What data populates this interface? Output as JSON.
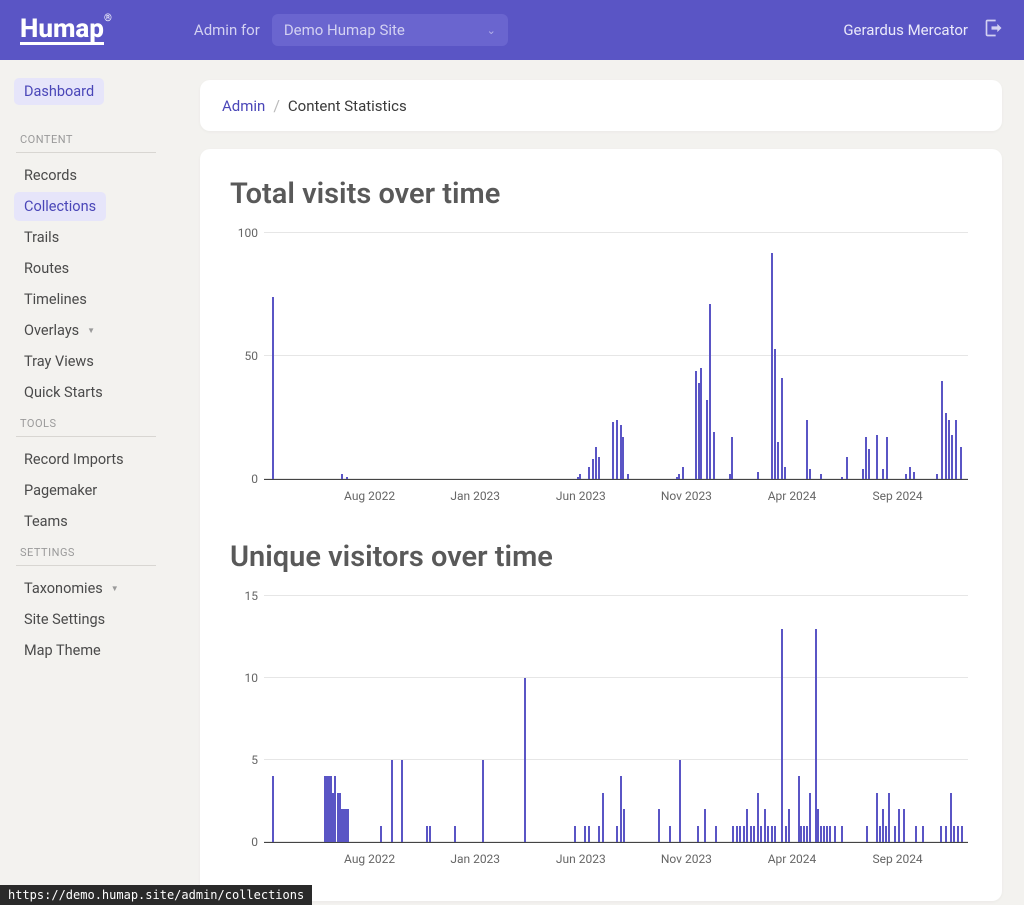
{
  "brand": "Humap",
  "header": {
    "admin_for_label": "Admin for",
    "site_name": "Demo Humap Site",
    "username": "Gerardus Mercator"
  },
  "sidebar": {
    "dashboard": "Dashboard",
    "sections": [
      {
        "label": "CONTENT",
        "items": [
          {
            "label": "Records",
            "dropdown": false,
            "highlight": false
          },
          {
            "label": "Collections",
            "dropdown": false,
            "highlight": true
          },
          {
            "label": "Trails",
            "dropdown": false,
            "highlight": false
          },
          {
            "label": "Routes",
            "dropdown": false,
            "highlight": false
          },
          {
            "label": "Timelines",
            "dropdown": false,
            "highlight": false
          },
          {
            "label": "Overlays",
            "dropdown": true,
            "highlight": false
          },
          {
            "label": "Tray Views",
            "dropdown": false,
            "highlight": false
          },
          {
            "label": "Quick Starts",
            "dropdown": false,
            "highlight": false
          }
        ]
      },
      {
        "label": "TOOLS",
        "items": [
          {
            "label": "Record Imports",
            "dropdown": false,
            "highlight": false
          },
          {
            "label": "Pagemaker",
            "dropdown": false,
            "highlight": false
          },
          {
            "label": "Teams",
            "dropdown": false,
            "highlight": false
          }
        ]
      },
      {
        "label": "SETTINGS",
        "items": [
          {
            "label": "Taxonomies",
            "dropdown": true,
            "highlight": false
          },
          {
            "label": "Site Settings",
            "dropdown": false,
            "highlight": false
          },
          {
            "label": "Map Theme",
            "dropdown": false,
            "highlight": false
          }
        ]
      }
    ]
  },
  "breadcrumb": {
    "root": "Admin",
    "current": "Content Statistics"
  },
  "status_url": "https://demo.humap.site/admin/collections",
  "chart_data": [
    {
      "type": "bar",
      "title": "Total visits over time",
      "ylim": [
        0,
        100
      ],
      "yticks": [
        0,
        50,
        100
      ],
      "xticks": [
        "Aug 2022",
        "Jan 2023",
        "Jun 2023",
        "Nov 2023",
        "Apr 2024",
        "Sep 2024"
      ],
      "xtick_pos": [
        0.15,
        0.3,
        0.45,
        0.6,
        0.75,
        0.9
      ],
      "bars": [
        {
          "x": 0.012,
          "v": 74
        },
        {
          "x": 0.11,
          "v": 2
        },
        {
          "x": 0.116,
          "v": 1
        },
        {
          "x": 0.445,
          "v": 1
        },
        {
          "x": 0.448,
          "v": 2
        },
        {
          "x": 0.46,
          "v": 5
        },
        {
          "x": 0.466,
          "v": 8
        },
        {
          "x": 0.47,
          "v": 13
        },
        {
          "x": 0.474,
          "v": 9
        },
        {
          "x": 0.495,
          "v": 23
        },
        {
          "x": 0.5,
          "v": 24
        },
        {
          "x": 0.505,
          "v": 22
        },
        {
          "x": 0.508,
          "v": 17
        },
        {
          "x": 0.515,
          "v": 2
        },
        {
          "x": 0.585,
          "v": 1
        },
        {
          "x": 0.588,
          "v": 2
        },
        {
          "x": 0.594,
          "v": 5
        },
        {
          "x": 0.612,
          "v": 44
        },
        {
          "x": 0.616,
          "v": 39
        },
        {
          "x": 0.62,
          "v": 45
        },
        {
          "x": 0.628,
          "v": 32
        },
        {
          "x": 0.632,
          "v": 71
        },
        {
          "x": 0.638,
          "v": 19
        },
        {
          "x": 0.66,
          "v": 2
        },
        {
          "x": 0.664,
          "v": 17
        },
        {
          "x": 0.7,
          "v": 3
        },
        {
          "x": 0.72,
          "v": 92
        },
        {
          "x": 0.724,
          "v": 53
        },
        {
          "x": 0.728,
          "v": 15
        },
        {
          "x": 0.734,
          "v": 41
        },
        {
          "x": 0.738,
          "v": 5
        },
        {
          "x": 0.77,
          "v": 24
        },
        {
          "x": 0.774,
          "v": 4
        },
        {
          "x": 0.79,
          "v": 2
        },
        {
          "x": 0.82,
          "v": 1
        },
        {
          "x": 0.826,
          "v": 9
        },
        {
          "x": 0.85,
          "v": 4
        },
        {
          "x": 0.854,
          "v": 17
        },
        {
          "x": 0.858,
          "v": 12
        },
        {
          "x": 0.87,
          "v": 18
        },
        {
          "x": 0.878,
          "v": 4
        },
        {
          "x": 0.884,
          "v": 17
        },
        {
          "x": 0.91,
          "v": 2
        },
        {
          "x": 0.916,
          "v": 5
        },
        {
          "x": 0.922,
          "v": 3
        },
        {
          "x": 0.955,
          "v": 2
        },
        {
          "x": 0.962,
          "v": 40
        },
        {
          "x": 0.968,
          "v": 27
        },
        {
          "x": 0.972,
          "v": 24
        },
        {
          "x": 0.976,
          "v": 18
        },
        {
          "x": 0.982,
          "v": 24
        },
        {
          "x": 0.988,
          "v": 13
        }
      ]
    },
    {
      "type": "bar",
      "title": "Unique visitors over time",
      "ylim": [
        0,
        15
      ],
      "yticks": [
        0,
        5,
        10,
        15
      ],
      "xticks": [
        "Aug 2022",
        "Jan 2023",
        "Jun 2023",
        "Nov 2023",
        "Apr 2024",
        "Sep 2024"
      ],
      "xtick_pos": [
        0.15,
        0.3,
        0.45,
        0.6,
        0.75,
        0.9
      ],
      "bars": [
        {
          "x": 0.012,
          "v": 4
        },
        {
          "x": 0.085,
          "v": 4
        },
        {
          "x": 0.088,
          "v": 4
        },
        {
          "x": 0.091,
          "v": 4
        },
        {
          "x": 0.094,
          "v": 4
        },
        {
          "x": 0.097,
          "v": 3
        },
        {
          "x": 0.1,
          "v": 4
        },
        {
          "x": 0.103,
          "v": 3
        },
        {
          "x": 0.106,
          "v": 3
        },
        {
          "x": 0.109,
          "v": 2
        },
        {
          "x": 0.112,
          "v": 2
        },
        {
          "x": 0.115,
          "v": 2
        },
        {
          "x": 0.118,
          "v": 2
        },
        {
          "x": 0.165,
          "v": 1
        },
        {
          "x": 0.18,
          "v": 5
        },
        {
          "x": 0.195,
          "v": 5
        },
        {
          "x": 0.23,
          "v": 1
        },
        {
          "x": 0.235,
          "v": 1
        },
        {
          "x": 0.27,
          "v": 1
        },
        {
          "x": 0.31,
          "v": 5
        },
        {
          "x": 0.37,
          "v": 10
        },
        {
          "x": 0.44,
          "v": 1
        },
        {
          "x": 0.455,
          "v": 1
        },
        {
          "x": 0.46,
          "v": 1
        },
        {
          "x": 0.475,
          "v": 1
        },
        {
          "x": 0.48,
          "v": 3
        },
        {
          "x": 0.5,
          "v": 1
        },
        {
          "x": 0.505,
          "v": 4
        },
        {
          "x": 0.51,
          "v": 2
        },
        {
          "x": 0.56,
          "v": 2
        },
        {
          "x": 0.575,
          "v": 1
        },
        {
          "x": 0.59,
          "v": 5
        },
        {
          "x": 0.615,
          "v": 1
        },
        {
          "x": 0.625,
          "v": 2
        },
        {
          "x": 0.64,
          "v": 1
        },
        {
          "x": 0.665,
          "v": 1
        },
        {
          "x": 0.67,
          "v": 1
        },
        {
          "x": 0.675,
          "v": 1
        },
        {
          "x": 0.68,
          "v": 1
        },
        {
          "x": 0.685,
          "v": 2
        },
        {
          "x": 0.69,
          "v": 1
        },
        {
          "x": 0.695,
          "v": 1
        },
        {
          "x": 0.7,
          "v": 3
        },
        {
          "x": 0.705,
          "v": 1
        },
        {
          "x": 0.71,
          "v": 2
        },
        {
          "x": 0.715,
          "v": 1
        },
        {
          "x": 0.72,
          "v": 1
        },
        {
          "x": 0.725,
          "v": 1
        },
        {
          "x": 0.735,
          "v": 13
        },
        {
          "x": 0.74,
          "v": 1
        },
        {
          "x": 0.745,
          "v": 2
        },
        {
          "x": 0.758,
          "v": 4
        },
        {
          "x": 0.762,
          "v": 1
        },
        {
          "x": 0.766,
          "v": 1
        },
        {
          "x": 0.77,
          "v": 1
        },
        {
          "x": 0.774,
          "v": 3
        },
        {
          "x": 0.782,
          "v": 13
        },
        {
          "x": 0.786,
          "v": 2
        },
        {
          "x": 0.79,
          "v": 1
        },
        {
          "x": 0.794,
          "v": 1
        },
        {
          "x": 0.798,
          "v": 1
        },
        {
          "x": 0.802,
          "v": 1
        },
        {
          "x": 0.81,
          "v": 1
        },
        {
          "x": 0.82,
          "v": 1
        },
        {
          "x": 0.855,
          "v": 1
        },
        {
          "x": 0.87,
          "v": 3
        },
        {
          "x": 0.874,
          "v": 1
        },
        {
          "x": 0.878,
          "v": 2
        },
        {
          "x": 0.882,
          "v": 1
        },
        {
          "x": 0.886,
          "v": 3
        },
        {
          "x": 0.895,
          "v": 1
        },
        {
          "x": 0.9,
          "v": 2
        },
        {
          "x": 0.908,
          "v": 2
        },
        {
          "x": 0.925,
          "v": 1
        },
        {
          "x": 0.935,
          "v": 1
        },
        {
          "x": 0.96,
          "v": 1
        },
        {
          "x": 0.968,
          "v": 1
        },
        {
          "x": 0.974,
          "v": 3
        },
        {
          "x": 0.978,
          "v": 1
        },
        {
          "x": 0.984,
          "v": 1
        },
        {
          "x": 0.99,
          "v": 1
        }
      ]
    }
  ]
}
